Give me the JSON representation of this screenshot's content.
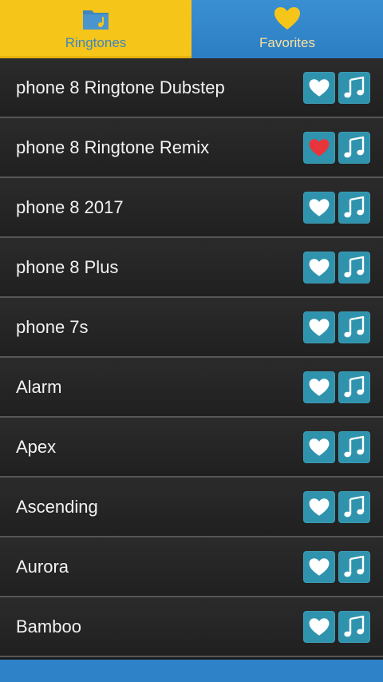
{
  "tabs": {
    "ringtones": {
      "label": "Ringtones",
      "icon": "folder-music-icon"
    },
    "favorites": {
      "label": "Favorites",
      "icon": "heart-icon"
    }
  },
  "colors": {
    "tab_active": "#f6c519",
    "tab_inactive": "#2c7ec2",
    "button": "#2f93ad",
    "heart_active": "#e8343b"
  },
  "ringtones": [
    {
      "title": "phone 8 Ringtone Dubstep",
      "favorite": false
    },
    {
      "title": "phone 8 Ringtone Remix",
      "favorite": true
    },
    {
      "title": "phone 8 2017",
      "favorite": false
    },
    {
      "title": "phone 8 Plus",
      "favorite": false
    },
    {
      "title": "phone 7s",
      "favorite": false
    },
    {
      "title": "Alarm",
      "favorite": false
    },
    {
      "title": "Apex",
      "favorite": false
    },
    {
      "title": "Ascending",
      "favorite": false
    },
    {
      "title": "Aurora",
      "favorite": false
    },
    {
      "title": "Bamboo",
      "favorite": false
    }
  ]
}
